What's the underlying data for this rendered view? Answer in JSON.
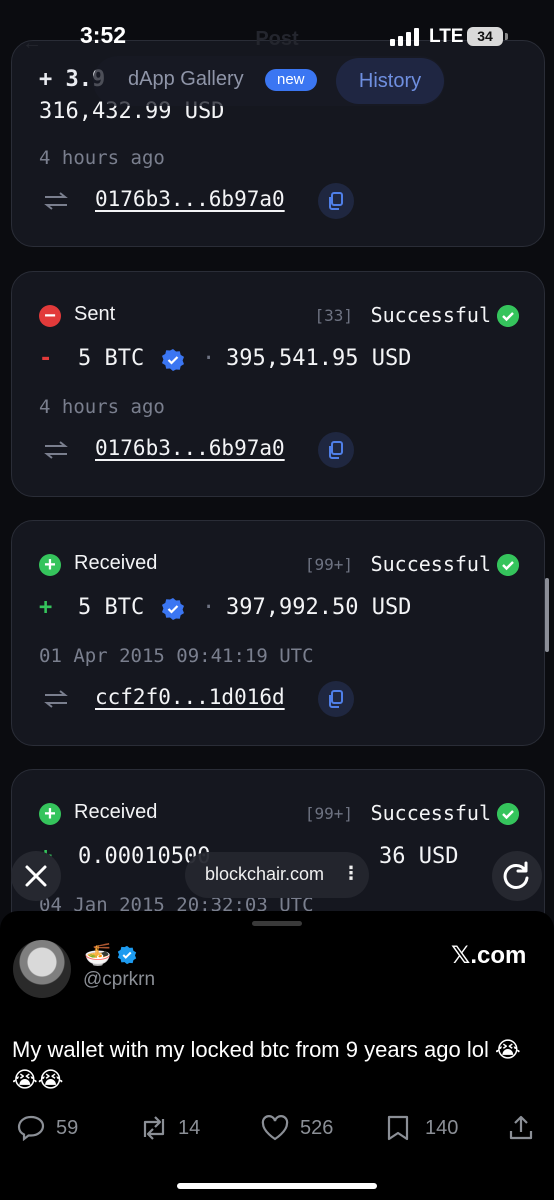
{
  "status_bar": {
    "time": "3:52",
    "network": "LTE",
    "battery": "34"
  },
  "header_ghost": {
    "title": "Post"
  },
  "top_tabs": {
    "gallery": "dApp Gallery",
    "new_badge": "new",
    "history": "History"
  },
  "cards": [
    {
      "amount_partial": "+ 3.9",
      "usd": "316,432.99 USD",
      "time": "4 hours ago",
      "hash": "0176b3...6b97a0"
    },
    {
      "type": "Sent",
      "confirmations": "[33]",
      "status": "Successful",
      "sign": "-",
      "btc": "5 BTC",
      "sep": "·",
      "usd": "395,541.95 USD",
      "time": "4 hours ago",
      "hash": "0176b3...6b97a0"
    },
    {
      "type": "Received",
      "confirmations": "[99+]",
      "status": "Successful",
      "sign": "+",
      "btc": "5 BTC",
      "sep": "·",
      "usd": "397,992.50 USD",
      "time": "01 Apr 2015 09:41:19 UTC",
      "hash": "ccf2f0...1d016d"
    },
    {
      "type": "Received",
      "confirmations": "[99+]",
      "status": "Successful",
      "sign": "+",
      "btc_partial": "0.00010500",
      "usd_partial": "36 USD",
      "time": "04 Jan 2015 20:32:03 UTC"
    }
  ],
  "browser": {
    "url": "blockchair.com",
    "menu": "⋮"
  },
  "tweet": {
    "name_emoji": "🍜",
    "handle": "@cprkrn",
    "site": "𝕏.com",
    "text": "My wallet with my locked btc from 9 years ago lol 😭😭😭",
    "replies": "59",
    "reposts": "14",
    "likes": "526",
    "bookmarks": "140"
  },
  "colors": {
    "sent": "#e23a3a",
    "received": "#35c45c",
    "accent": "#3b76f2"
  }
}
